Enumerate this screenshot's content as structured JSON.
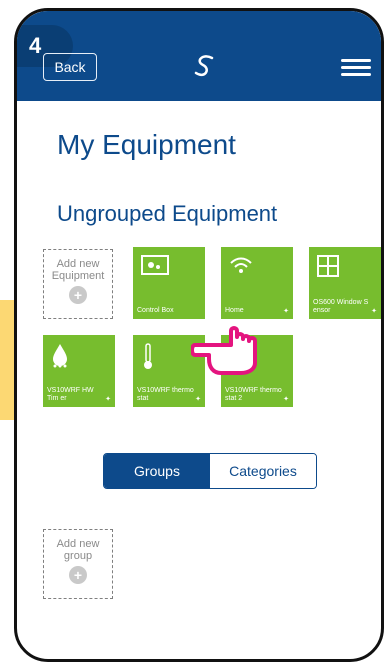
{
  "step_badge": "4",
  "header": {
    "back_label": "Back",
    "logo_icon": "s-logo-icon",
    "menu_icon": "hamburger-icon",
    "bg_color": "#0d4a8b"
  },
  "page_title": "My Equipment",
  "section_title": "Ungrouped Equipment",
  "equipment": {
    "add_label_line1": "Add new",
    "add_label_line2": "Equipment",
    "items": [
      {
        "label": "Control Box",
        "icon": "control-box-icon"
      },
      {
        "label": "Home",
        "icon": "wifi-icon"
      },
      {
        "label": "OS600 Window S ensor",
        "icon": "window-icon"
      },
      {
        "label": "VS10WRF HW Tim er",
        "icon": "water-drop-icon"
      },
      {
        "label": "VS10WRF thermo stat",
        "icon": "thermometer-icon"
      },
      {
        "label": "VS10WRF thermo stat 2",
        "icon": "tile-icon"
      }
    ]
  },
  "tabs": {
    "groups": "Groups",
    "categories": "Categories"
  },
  "group": {
    "add_line1": "Add new",
    "add_line2": "group"
  },
  "colors": {
    "primary": "#0d4a8b",
    "tile": "#77bd2e",
    "accent": "#fcd873",
    "hand": "#e4147f"
  }
}
